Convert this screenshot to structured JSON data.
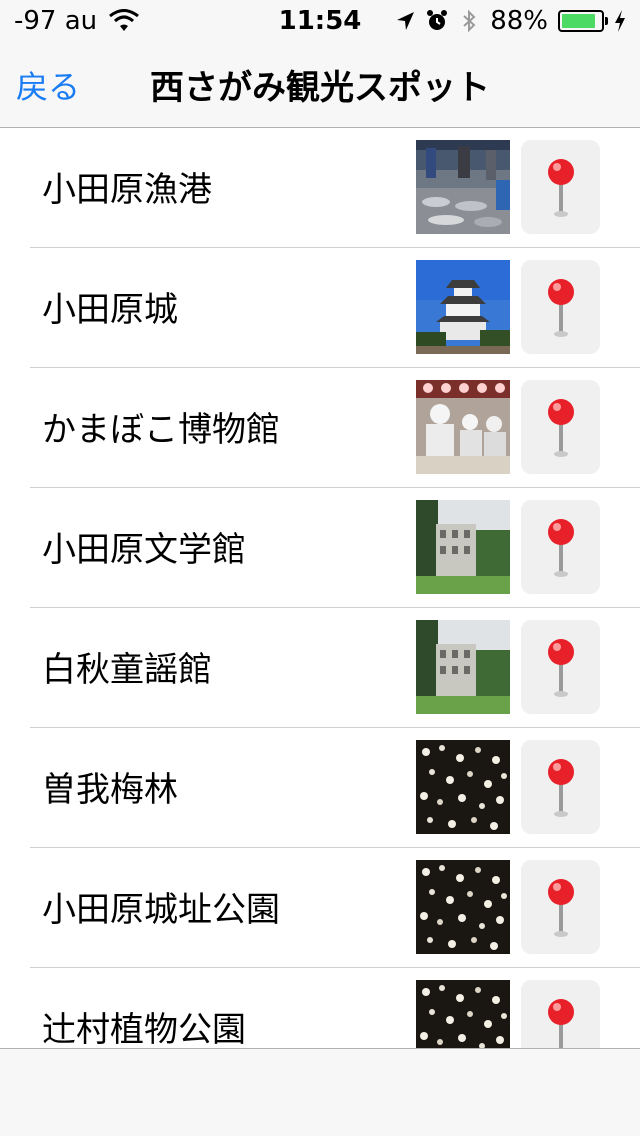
{
  "status_bar": {
    "carrier": "-97 au",
    "time": "11:54",
    "battery_percent": "88%",
    "battery_level": 0.88,
    "icons": [
      "wifi-icon",
      "location-arrow-icon",
      "alarm-clock-icon",
      "bluetooth-icon",
      "battery-icon",
      "charging-bolt-icon"
    ]
  },
  "nav": {
    "back_label": "戻る",
    "title": "西さがみ観光スポット"
  },
  "colors": {
    "accent": "#1a7cf5",
    "battery": "#4cd964",
    "pin": "#e8202a"
  },
  "spots": [
    {
      "name": "小田原漁港",
      "thumbnail": "fish-market-photo",
      "action_icon": "map-pin-icon"
    },
    {
      "name": "小田原城",
      "thumbnail": "castle-photo",
      "action_icon": "map-pin-icon"
    },
    {
      "name": "かまぼこ博物館",
      "thumbnail": "museum-workshop-photo",
      "action_icon": "map-pin-icon"
    },
    {
      "name": "小田原文学館",
      "thumbnail": "literature-museum-photo",
      "action_icon": "map-pin-icon"
    },
    {
      "name": "白秋童謡館",
      "thumbnail": "literature-museum-photo",
      "action_icon": "map-pin-icon"
    },
    {
      "name": "曽我梅林",
      "thumbnail": "plum-blossom-photo",
      "action_icon": "map-pin-icon"
    },
    {
      "name": "小田原城址公園",
      "thumbnail": "plum-blossom-photo",
      "action_icon": "map-pin-icon"
    },
    {
      "name": "辻村植物公園",
      "thumbnail": "plum-blossom-photo",
      "action_icon": "map-pin-icon"
    }
  ]
}
